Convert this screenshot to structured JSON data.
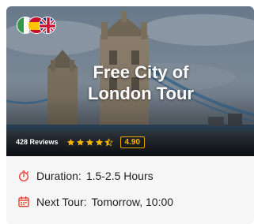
{
  "tour": {
    "title_line1": "Free City of",
    "title_line2": "London Tour",
    "reviews": "428 Reviews",
    "rating_score": "4.90",
    "stars": 4.5,
    "duration_label": "Duration:",
    "duration_value": "1.5-2.5 Hours",
    "next_tour_label": "Next Tour:",
    "next_tour_value": "Tomorrow, 10:00"
  },
  "flags": [
    "italy-flag-icon",
    "spain-flag-icon",
    "uk-flag-icon"
  ],
  "colors": {
    "accent_red": "#e63b2e",
    "star_gold": "#f4b400",
    "card_bg": "#f6f6f6"
  }
}
